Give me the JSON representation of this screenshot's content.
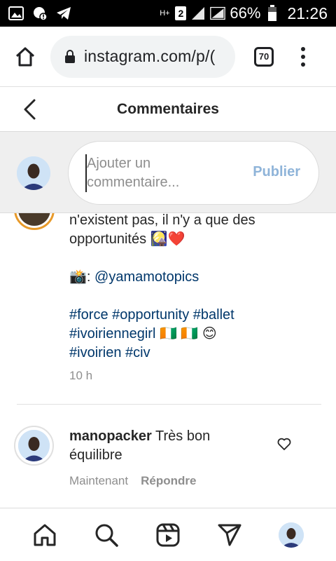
{
  "status_bar": {
    "battery_percent": "66%",
    "time": "21:26",
    "sim_slot": "2",
    "network_type": "H+",
    "icons": [
      "gallery-icon",
      "alert-icon",
      "telegram-icon",
      "network-icon",
      "signal-icon",
      "battery-icon"
    ]
  },
  "browser": {
    "url": "instagram.com/p/(",
    "tab_count": "70"
  },
  "page": {
    "title": "Commentaires"
  },
  "comment_input": {
    "placeholder": "Ajouter un commentaire...",
    "publish_label": "Publier"
  },
  "post": {
    "caption_line1": "n'existent pas, il n'y a que des",
    "caption_line2": "opportunités 🎑❤️",
    "credit_prefix": "📸: ",
    "credit_handle": "@yamamotopics",
    "hashtags_line1": "#force #opportunity #ballet",
    "hashtags_line2": "#ivoiriennegirl",
    "hashtags_line2_emoji": " 🇨🇮 🇨🇮 😊",
    "hashtags_line3": "#ivoirien #civ",
    "time": "10 h"
  },
  "comment": {
    "username": "manopacker",
    "text": "Très bon équilibre",
    "time": "Maintenant",
    "reply_label": "Répondre"
  },
  "nav": {
    "items": [
      "home-icon",
      "search-icon",
      "reels-icon",
      "direct-icon",
      "profile-avatar"
    ]
  }
}
